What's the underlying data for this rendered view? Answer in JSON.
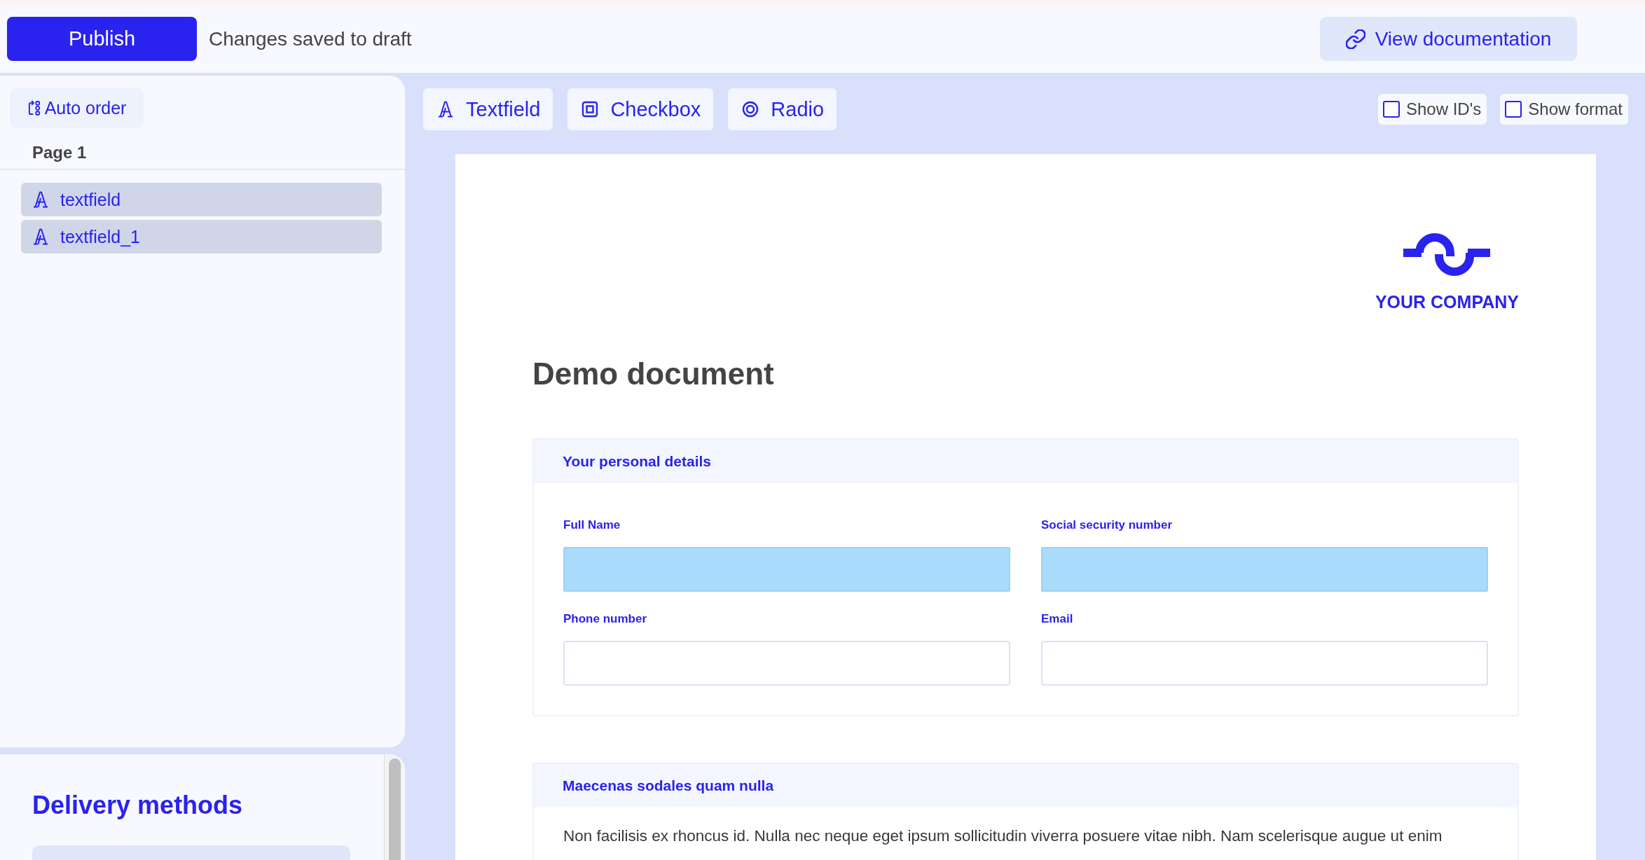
{
  "top_bar": {
    "publish_button": "Publish",
    "status": "Changes saved to draft",
    "documentation_link": "View documentation"
  },
  "sidebar": {
    "auto_order_button": "Auto order",
    "page_title": "Page 1",
    "items": [
      {
        "kind": "textfield",
        "label": "textfield"
      },
      {
        "kind": "textfield",
        "label": "textfield_1"
      }
    ]
  },
  "delivery_panel": {
    "title": "Delivery methods"
  },
  "toolbar": {
    "tools": [
      {
        "kind": "textfield",
        "label": "Textfield"
      },
      {
        "kind": "checkbox",
        "label": "Checkbox"
      },
      {
        "kind": "radio",
        "label": "Radio"
      }
    ],
    "toggles": [
      {
        "label": "Show ID's",
        "checked": false
      },
      {
        "label": "Show format",
        "checked": false
      }
    ]
  },
  "document": {
    "logo_text": "YOUR COMPANY",
    "title": "Demo document",
    "sections": [
      {
        "kind": "fields",
        "title": "Your personal details",
        "fields": [
          {
            "label": "Full Name",
            "highlighted": true
          },
          {
            "label": "Social security number",
            "highlighted": true
          },
          {
            "label": "Phone number",
            "highlighted": false
          },
          {
            "label": "Email",
            "highlighted": false
          }
        ]
      },
      {
        "kind": "text",
        "title": "Maecenas sodales quam nulla",
        "text": "Non facilisis ex rhoncus id. Nulla nec neque eget ipsum sollicitudin viverra posuere vitae nibh. Nam scelerisque augue ut enim"
      }
    ]
  }
}
